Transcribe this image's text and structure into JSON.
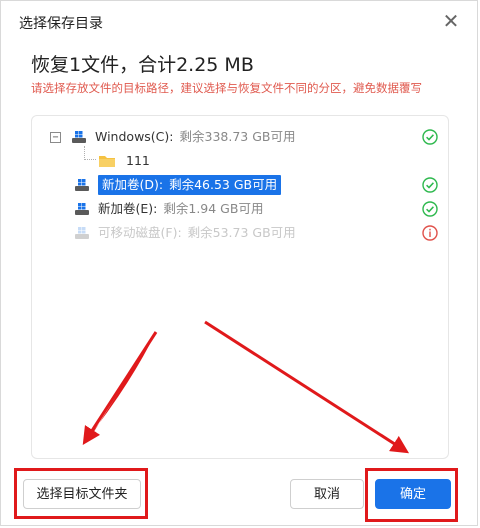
{
  "dialog": {
    "title": "选择保存目录",
    "close_symbol": "✕",
    "heading": "恢复1文件，合计2.25 MB",
    "hint": "请选择存放文件的目标路径，建议选择与恢复文件不同的分区，避免数据覆写"
  },
  "tree": {
    "expander_symbol": "−",
    "drives": [
      {
        "name": "Windows(C):",
        "free": "剩余338.73 GB可用",
        "status": "ok"
      },
      {
        "name": "新加卷(D):",
        "free": "剩余46.53 GB可用",
        "status": "ok",
        "selected": true
      },
      {
        "name": "新加卷(E):",
        "free": "剩余1.94 GB可用",
        "status": "ok"
      },
      {
        "name": "可移动磁盘(F):",
        "free": "剩余53.73 GB可用",
        "status": "warning",
        "disabled": true
      }
    ],
    "folder": {
      "name": "111"
    }
  },
  "buttons": {
    "choose_folder": "选择目标文件夹",
    "cancel": "取消",
    "ok": "确定"
  },
  "colors": {
    "accent": "#1a73e8",
    "hint": "#e05a4f",
    "ok": "#2db84d",
    "warning": "#e0504a",
    "annotation": "#e0191b"
  },
  "icons": {
    "close": "close-icon",
    "drive": "windows-drive-icon",
    "folder": "folder-icon",
    "ok": "check-circle-icon",
    "warning": "info-circle-icon"
  }
}
